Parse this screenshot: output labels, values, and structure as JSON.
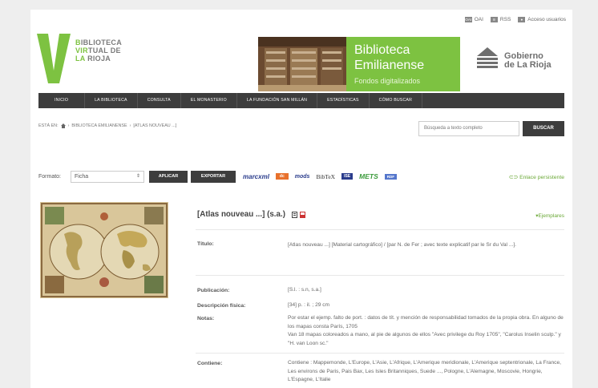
{
  "top_links": {
    "oai": "OAI",
    "rss": "RSS",
    "users": "Acceso usuarios"
  },
  "logo": {
    "line1_a": "B",
    "line1_b": "IBLIOTECA",
    "line2_a": "VIR",
    "line2_b": "TUAL DE",
    "line3_a": "LA ",
    "line3_b": "RIOJA"
  },
  "banner": {
    "title1": "Biblioteca",
    "title2": "Emilianense",
    "subtitle": "Fondos digitalizados"
  },
  "gobierno": {
    "line1": "Gobierno",
    "line2": "de La Rioja"
  },
  "nav": {
    "items": [
      "INICIO",
      "LA BIBLIOTECA",
      "CONSULTA",
      "EL MONASTERIO",
      "LA FUNDACIÓN SAN MILLÁN",
      "ESTADÍSTICAS",
      "CÓMO BUSCAR"
    ]
  },
  "breadcrumb": {
    "prefix": "ESTÁ EN:",
    "sep1": "›",
    "crumb1": "BIBLIOTECA EMILIANENSE",
    "sep2": "›",
    "crumb2": "[ATLAS NOUVEAU ...]"
  },
  "search": {
    "placeholder": "Búsqueda a texto completo",
    "button": "BUSCAR"
  },
  "format_bar": {
    "label": "Formato:",
    "selected": "Ficha",
    "apply": "APLICAR",
    "export": "EXPORTAR",
    "formats": [
      "marcxml",
      "dc",
      "mods",
      "BibTeX",
      "ISE",
      "METS",
      "RDF"
    ],
    "format_labels": {
      "marc": "marcxml",
      "dc": "dc",
      "mods": "mods",
      "bibtex": "BibTeX",
      "ise": "ISE",
      "mets": "METS",
      "rdf": "RDF"
    },
    "permalink": "Enlace persistente"
  },
  "record": {
    "title": "[Atlas nouveau ...] (s.a.)",
    "ejemplares": "Ejemplares",
    "fields": [
      {
        "label": "Título:",
        "value": "[Atlas nouveau ...] [Material cartográfico] / [par N. de Fer ; avec texte explicatif par le Sr du Val ...]."
      },
      {
        "label": "Publicación:",
        "value": "[S.l. : s.n, s.a.]"
      },
      {
        "label": "Descripción física:",
        "value": "[34] p. : il. ; 29 cm"
      },
      {
        "label": "Notas:",
        "value": "Por estar el ejemp. falto de port. : datos de tít. y mención de responsabilidad tomados de la propia obra. En alguno de los mapas consta París, 1705\nVan 18 mapas coloreados a mano, al pie de algunos de ellos \"Avec privilege du Roy 1705\", \"Carolus Inselin sculp.\" y \"H. van Loon sc.\""
      },
      {
        "label": "Contiene:",
        "value": "Contiene : Mappemonde, L'Europe, L'Asie, L'Afrique, L'Amerique meridionale, L'Amerique septentrionale, La France, Les environs de Paris, Pais Bax, Les Isles Britanniques, Suede ..., Pologne, L'Alemagne, Moscovie, Hongrie, L'Espagne, L'Italie"
      }
    ]
  },
  "colors": {
    "brand_green": "#7dc241",
    "nav_dark": "#3d3d3d",
    "link_green": "#6aa836"
  }
}
